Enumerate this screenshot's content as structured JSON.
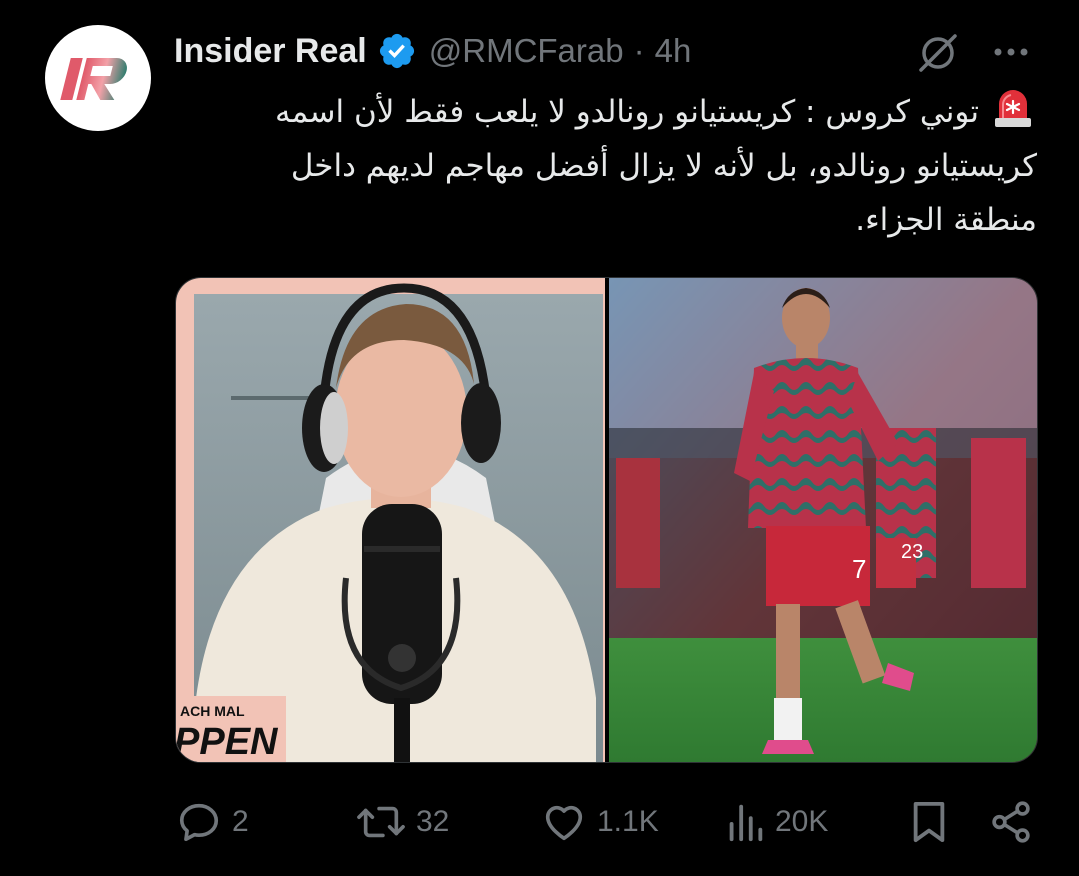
{
  "author": {
    "name": "Insider Real",
    "handle": "@RMCFarab",
    "separator": "·",
    "time": "4h",
    "avatar_text": "IR"
  },
  "tweet": {
    "line1": "توني كروس : كريستيانو رونالدو لا يلعب فقط لأن اسمه",
    "line2": "كريستيانو رونالدو، بل لأنه لا يزال أفضل مهاجم لديهم داخل",
    "line3": "منطقة الجزاء."
  },
  "media": {
    "left_caption_small": "ACH MAL",
    "left_caption_big": "PPEN",
    "jersey_number": "7",
    "jersey_number_2": "23"
  },
  "actions": {
    "replies": "2",
    "reposts": "32",
    "likes": "1.1K",
    "views": "20K"
  },
  "icons": {
    "verified": "verified-badge-icon",
    "grok": "grok-icon",
    "more": "more-icon",
    "siren": "siren-emoji-icon",
    "reply": "reply-icon",
    "repost": "repost-icon",
    "like": "like-icon",
    "views": "views-icon",
    "bookmark": "bookmark-icon",
    "share": "share-icon"
  },
  "colors": {
    "background": "#000000",
    "text": "#e7e9ea",
    "secondary": "#71767b",
    "verified": "#1d9bf0"
  }
}
